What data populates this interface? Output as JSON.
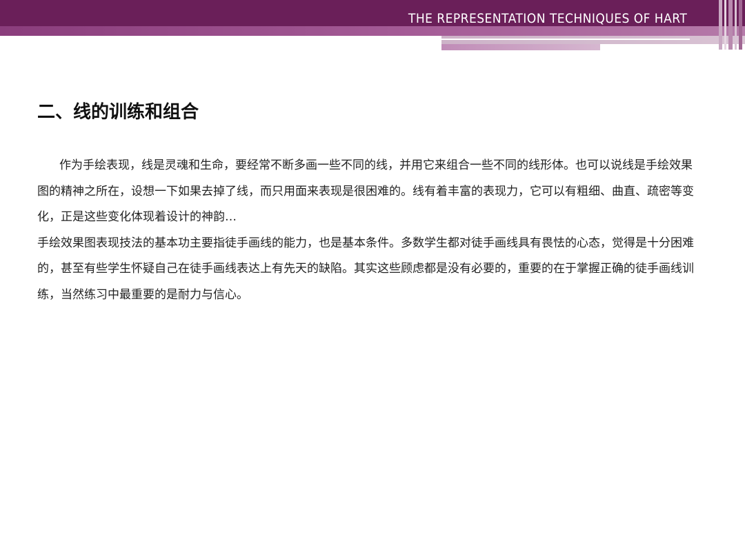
{
  "header": {
    "title": "THE  REPRESENTATION  TECHNIQUES  OF  HART"
  },
  "content": {
    "heading": "二、线的训练和组合",
    "paragraphs": [
      "作为手绘表现，线是灵魂和生命，要经常不断多画一些不同的线，并用它来组合一些不同的线形体。也可以说线是手绘效果图的精神之所在，设想一下如果去掉了线，而只用面来表现是很困难的。线有着丰富的表现力，它可以有粗细、曲直、疏密等变化，正是这些变化体现着设计的神韵…",
      "手绘效果图表现技法的基本功主要指徒手画线的能力，也是基本条件。多数学生都对徒手画线具有畏怯的心态，觉得是十分困难的，甚至有些学生怀疑自己在徒手画线表达上有先天的缺陷。其实这些顾虑都是没有必要的，重要的在于掌握正确的徒手画线训练，当然练习中最重要的是耐力与信心。"
    ]
  },
  "colors": {
    "header_dark": "#6a1f59",
    "header_stripe": "#a45b96",
    "header_light": "#d9c3d4"
  }
}
